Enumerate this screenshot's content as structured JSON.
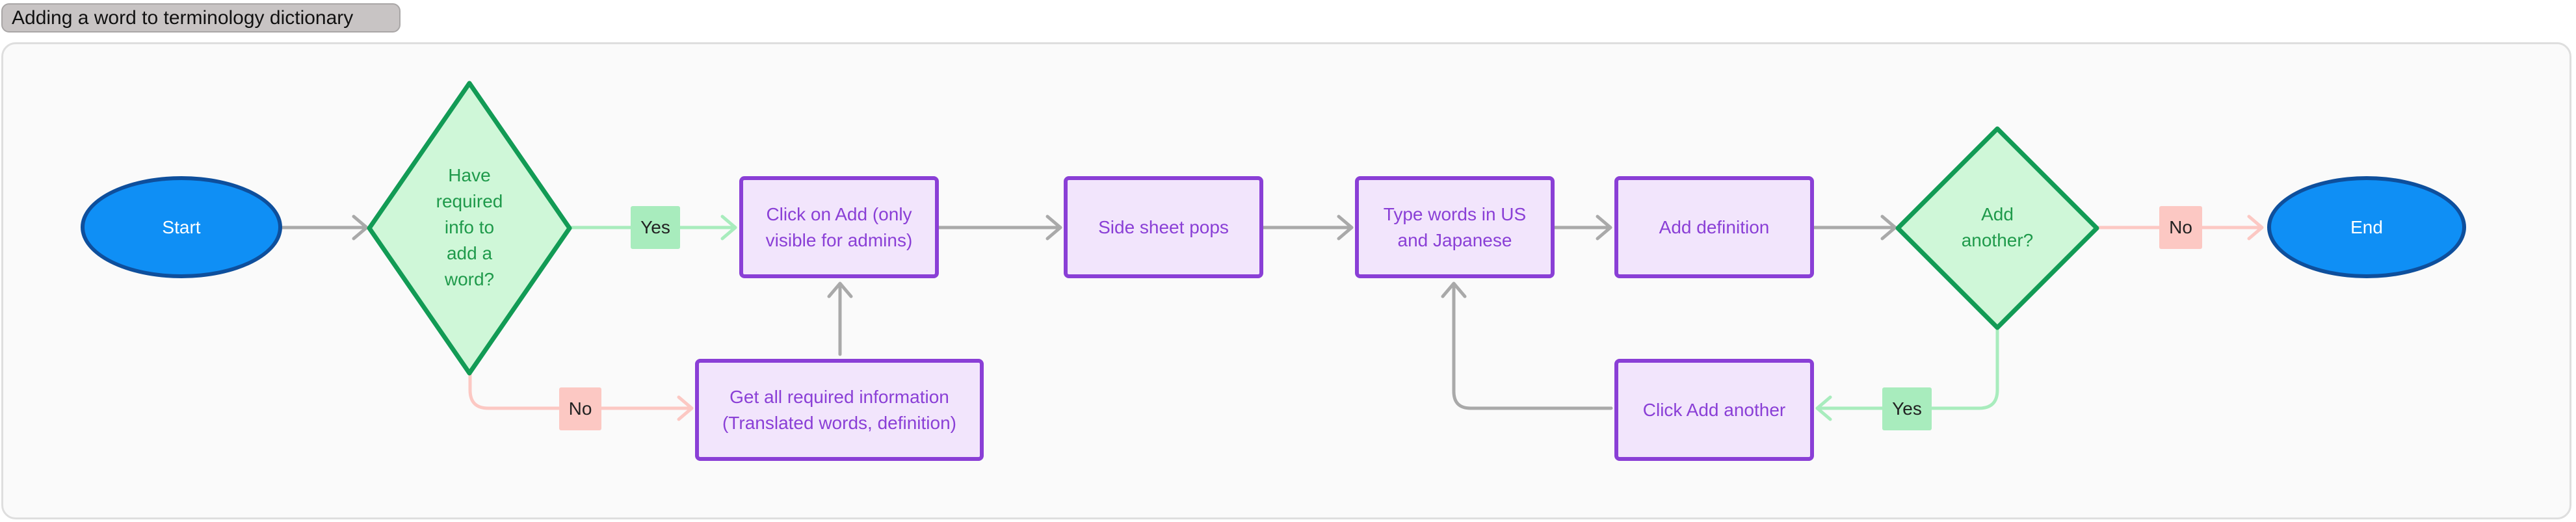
{
  "diagram": {
    "title": "Adding a word to terminology dictionary",
    "nodes": {
      "start": "Start",
      "decision_info": [
        "Have",
        "required",
        "info to",
        "add a",
        "word?"
      ],
      "click_add": [
        "Click on Add (only",
        "visible for admins)"
      ],
      "get_info": [
        "Get all required information",
        "(Translated words, definition)"
      ],
      "side_sheet": "Side sheet pops",
      "type_words": [
        "Type words in US",
        "and Japanese"
      ],
      "add_definition": "Add definition",
      "decision_another": [
        "Add",
        "another?"
      ],
      "click_add_another": "Click Add another",
      "end": "End"
    },
    "edges": {
      "yes_1": "Yes",
      "no_1": "No",
      "no_2": "No",
      "yes_2": "Yes"
    },
    "colors": {
      "process_fill": "#f2e5fc",
      "process_stroke": "#8a3fd6",
      "decision_fill": "#cff7d8",
      "decision_stroke": "#129b55",
      "terminal_fill": "#0f8ff5",
      "terminal_stroke": "#0e4f9c",
      "arrow_default": "#a9a9a9",
      "arrow_yes": "#a8ecbd",
      "arrow_no": "#fcc8c3"
    }
  }
}
